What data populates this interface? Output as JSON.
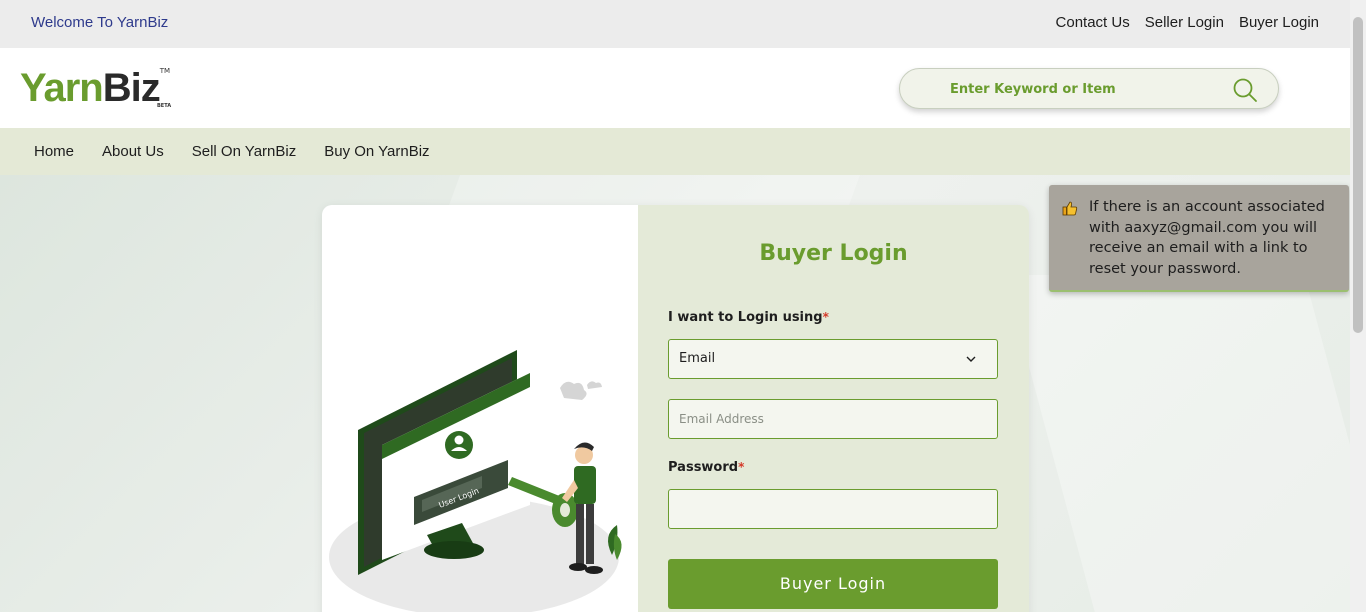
{
  "topbar": {
    "welcome": "Welcome To YarnBiz",
    "links": [
      "Contact Us",
      "Seller Login",
      "Buyer Login"
    ]
  },
  "header": {
    "logo_part1": "Yarn",
    "logo_part2": "Biz",
    "logo_tm": "TM",
    "logo_beta": "BETA",
    "search_placeholder": "Enter Keyword or Item",
    "search_icon": "search-icon"
  },
  "nav": {
    "items": [
      "Home",
      "About Us",
      "Sell On YarnBiz",
      "Buy On YarnBiz"
    ]
  },
  "login": {
    "title": "Buyer Login",
    "login_using_label": "I want to Login using",
    "required_mark": "*",
    "login_using_value": "Email",
    "email_placeholder": "Email Address",
    "password_label": "Password",
    "password_value": "",
    "submit_label": "Buyer Login",
    "illustration_text": "User Login"
  },
  "toast": {
    "icon": "thumbs-up-icon",
    "message": "If there is an account associated with aaxyz@gmail.com you will receive an email with a link to reset your password."
  },
  "colors": {
    "brand_green": "#6a9c2e",
    "nav_bg": "#e4e9d6",
    "welcome_text": "#2e3a8c"
  }
}
